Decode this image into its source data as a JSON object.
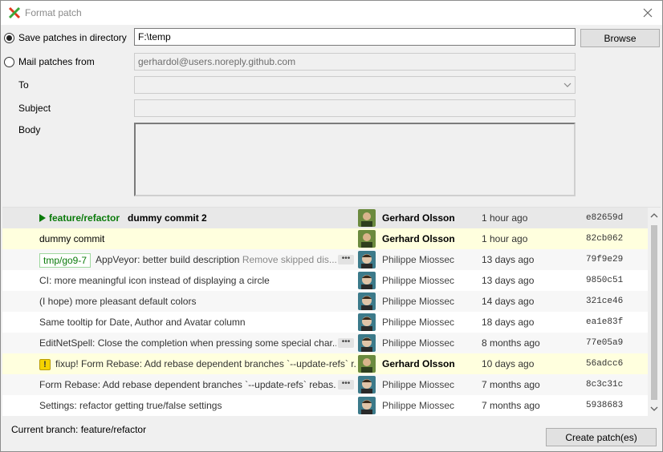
{
  "window": {
    "title": "Format patch",
    "app_icon": "gitextensions-icon",
    "close_icon": "close-icon"
  },
  "form": {
    "save_option_label": "Save patches in directory",
    "save_option_checked": true,
    "directory_value": "F:\\temp",
    "browse_label": "Browse",
    "mail_option_label": "Mail patches from",
    "mail_option_checked": false,
    "mail_from_value": "gerhardol@users.noreply.github.com",
    "to_label": "To",
    "to_value": "",
    "subject_label": "Subject",
    "subject_value": "",
    "body_label": "Body",
    "body_value": ""
  },
  "commits": [
    {
      "branch": "feature/refactor",
      "branch_style": "active",
      "message": "dummy commit 2",
      "bold": true,
      "author": "Gerhard Olsson",
      "author_bold": true,
      "date": "1 hour ago",
      "sha": "e82659d",
      "state": "selected"
    },
    {
      "branch": "",
      "message": "dummy commit",
      "bold": false,
      "author": "Gerhard Olsson",
      "author_bold": true,
      "date": "1 hour ago",
      "sha": "82cb062",
      "state": "hl"
    },
    {
      "branch": "tmp/go9-7",
      "message": "AppVeyor: better build description",
      "message_extra": "Remove skipped dis...",
      "more": true,
      "author": "Philippe Miossec",
      "date": "13 days ago",
      "sha": "79f9e29",
      "state": "normal"
    },
    {
      "branch": "",
      "message": "CI: more meaningful icon instead of displaying a circle",
      "author": "Philippe Miossec",
      "date": "13 days ago",
      "sha": "9850c51",
      "state": "alt"
    },
    {
      "branch": "",
      "message": "(I hope) more pleasant default colors",
      "author": "Philippe Miossec",
      "date": "14 days ago",
      "sha": "321ce46",
      "state": "normal"
    },
    {
      "branch": "",
      "message": "Same tooltip for Date, Author and Avatar column",
      "author": "Philippe Miossec",
      "date": "18 days ago",
      "sha": "ea1e83f",
      "state": "alt"
    },
    {
      "branch": "",
      "message": "EditNetSpell: Close the completion when pressing some special char...",
      "more": true,
      "author": "Philippe Miossec",
      "date": "8 months ago",
      "sha": "77e05a9",
      "state": "normal"
    },
    {
      "branch": "",
      "warn": true,
      "message": "fixup! Form Rebase: Add rebase dependent branches `--update-refs` r...",
      "author": "Gerhard Olsson",
      "author_bold": true,
      "date": "10 days ago",
      "sha": "56adcc6",
      "state": "hl"
    },
    {
      "branch": "",
      "message": "Form Rebase: Add rebase dependent branches `--update-refs` rebas...",
      "more": true,
      "author": "Philippe Miossec",
      "date": "7 months ago",
      "sha": "8c3c31c",
      "state": "normal"
    },
    {
      "branch": "",
      "message": "Settings: refactor getting true/false settings",
      "author": "Philippe Miossec",
      "date": "7 months ago",
      "sha": "5938683",
      "state": "alt"
    }
  ],
  "status": {
    "current_branch": "Current branch: feature/refactor"
  },
  "actions": {
    "create_label": "Create patch(es)"
  },
  "colors": {
    "graph_pink": "#e06090",
    "graph_grey": "#c8c8c8",
    "branch_green": "#0a7a0a",
    "highlight_row": "#ffffde"
  }
}
